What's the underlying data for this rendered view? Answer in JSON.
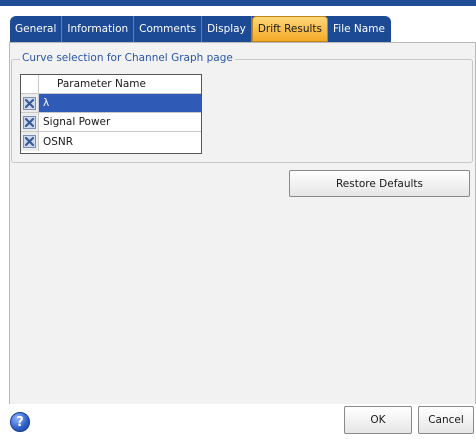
{
  "tabs": [
    {
      "label": "General"
    },
    {
      "label": "Information"
    },
    {
      "label": "Comments"
    },
    {
      "label": "Display"
    },
    {
      "label": "Drift Results",
      "active": true
    },
    {
      "label": "File Name"
    }
  ],
  "curve_group": {
    "legend": "Curve selection for Channel Graph page",
    "column_header": "Parameter Name",
    "rows": [
      {
        "name": "λ",
        "selected": true
      },
      {
        "name": "Signal Power",
        "selected": false
      },
      {
        "name": "OSNR",
        "selected": false
      }
    ]
  },
  "buttons": {
    "restore_defaults": "Restore Defaults",
    "ok": "OK",
    "cancel": "Cancel"
  },
  "icons": {
    "help": "?"
  },
  "colors": {
    "tab_strip": "#1c4a94",
    "active_tab": "#f4a928",
    "selection": "#2f5bb7",
    "legend_text": "#2a56a8"
  }
}
